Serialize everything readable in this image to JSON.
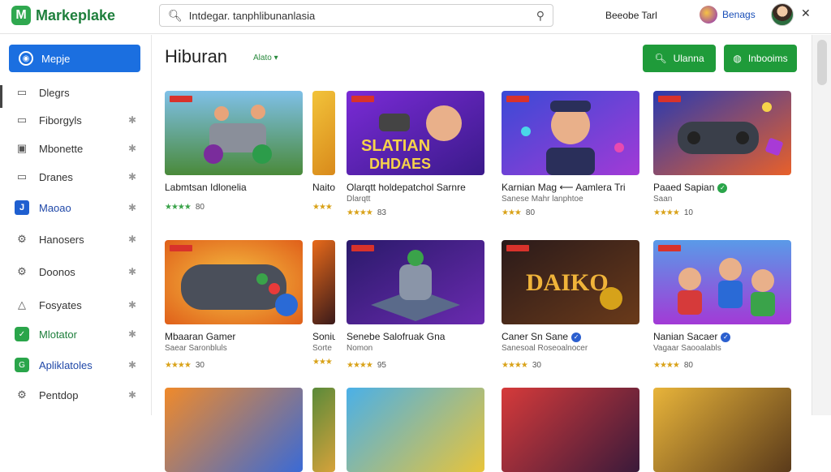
{
  "app": {
    "title": "Markeplake",
    "logo_glyph": "M",
    "brand_color": "#2fa84f"
  },
  "search": {
    "placeholder": "Intdegar. tanphlibunanlasia",
    "value": "Intdegar. tanphlibunanlasia"
  },
  "header": {
    "link": "Beeobe Tarl",
    "chip_label": "Benags"
  },
  "sidebar": {
    "primary": {
      "label": "Mepje",
      "icon": "compass-icon"
    },
    "items": [
      {
        "label": "Dlegrs",
        "icon": "square-icon",
        "pinned": false
      },
      {
        "label": "Fiborgyls",
        "icon": "square-icon",
        "pinned": true
      },
      {
        "label": "Mbonette",
        "icon": "image-icon",
        "pinned": true
      },
      {
        "label": "Dranes",
        "icon": "square-icon",
        "pinned": true
      },
      {
        "label": "Maoao",
        "icon": "j-badge-icon",
        "badge_text": "J",
        "pinned": true
      },
      {
        "label": "Hanosers",
        "icon": "gear-icon",
        "pinned": true
      },
      {
        "label": "Doonos",
        "icon": "gear-icon",
        "pinned": true
      },
      {
        "label": "Fosyates",
        "icon": "triangle-icon",
        "pinned": true
      },
      {
        "label": "Mlotator",
        "icon": "check-badge-icon",
        "pinned": true
      },
      {
        "label": "Apliklatoles",
        "icon": "g-badge-icon",
        "pinned": true
      },
      {
        "label": "Pentdop",
        "icon": "gear-icon",
        "pinned": true
      }
    ],
    "pin_glyph": "✱"
  },
  "main": {
    "title": "Hiburan",
    "sort_label": "Alato ▾",
    "buttons": [
      {
        "label": "Ulanna",
        "icon": "search-icon"
      },
      {
        "label": "Inbooims",
        "icon": "cart-icon"
      }
    ],
    "cards": [
      {
        "title": "Labmtsan Idlonelia",
        "subtitle": "",
        "stars": "★★★★",
        "star_color": "green",
        "rating": "80",
        "art": "car"
      },
      {
        "title": "Olarqtt holdepatchol Sarnre",
        "subtitle": "Dlarqtt",
        "stars": "★★★★",
        "star_color": "gold",
        "rating": "83",
        "art": "slatian"
      },
      {
        "title": "Karnian Mag ⟵ Aamlera Tri",
        "subtitle": "Sanese Mahr lanphtoe",
        "stars": "★★★",
        "star_color": "gold",
        "rating": "80",
        "art": "hero"
      },
      {
        "title": "Paaed Sapian",
        "subtitle": "Saan",
        "stars": "★★★★",
        "star_color": "gold",
        "rating": "10",
        "art": "controller",
        "verified": "green"
      },
      {
        "title": "Mbaaran Gamer",
        "subtitle": "Saear Saronbluls",
        "stars": "★★★★",
        "star_color": "gold",
        "rating": "30",
        "art": "gamepad"
      },
      {
        "title": "Senebe Salofruak Gna",
        "subtitle": "Nomon",
        "stars": "★★★★",
        "star_color": "gold",
        "rating": "95",
        "art": "robot"
      },
      {
        "title": "Caner Sn Sane",
        "subtitle": "Sanesoal Roseoalnocer",
        "stars": "★★★★",
        "star_color": "gold",
        "rating": "30",
        "art": "dairko",
        "verified": "blue"
      },
      {
        "title": "Nanian Sacaer",
        "subtitle": "Vagaar Saooalabls",
        "stars": "★★★★",
        "star_color": "gold",
        "rating": "80",
        "art": "squad",
        "verified": "blue"
      }
    ],
    "partials": [
      {
        "title": "Naito",
        "subtitle": "",
        "stars": "★★★",
        "rating": ""
      },
      {
        "title": "Soniu",
        "subtitle": "Sorte",
        "stars": "★★★",
        "rating": ""
      }
    ],
    "art_overlays": {
      "slatian": "SLATIAN\nDHDAES",
      "dairko": "DAIKO"
    }
  }
}
